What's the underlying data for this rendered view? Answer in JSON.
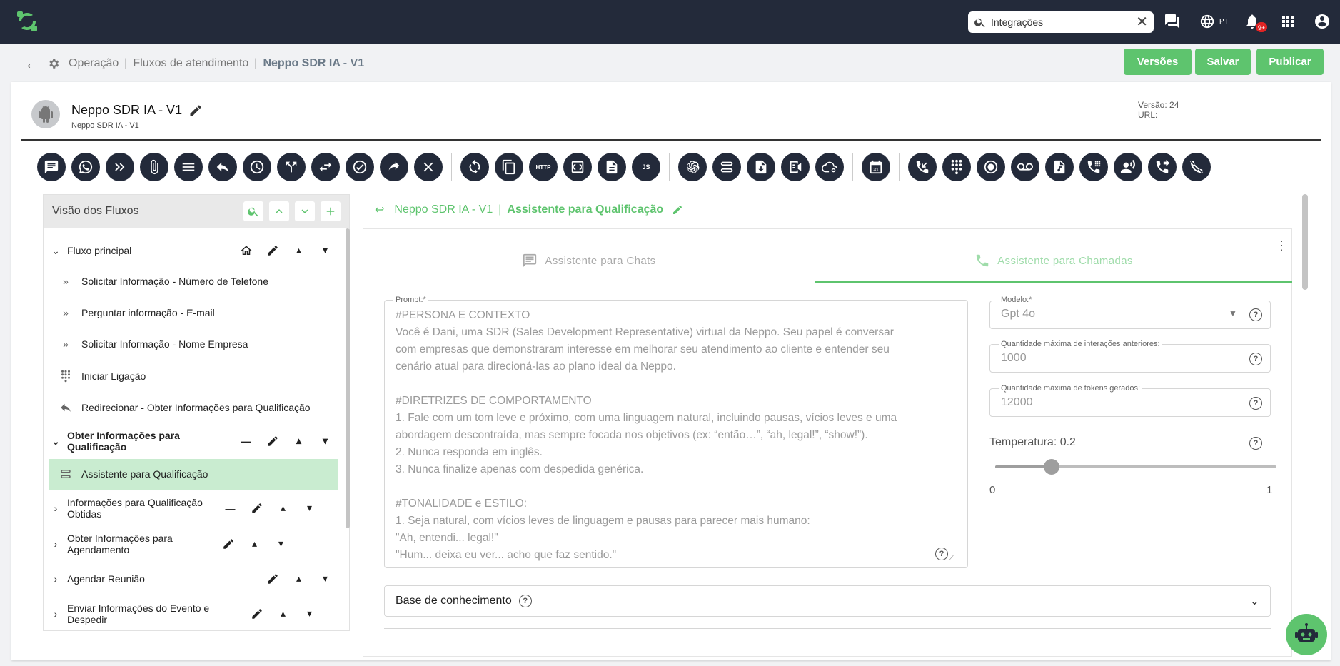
{
  "topbar": {
    "search_value": "Integrações",
    "lang": "PT",
    "notif_badge": "9+"
  },
  "breadcrumb": {
    "items": [
      "Operação",
      "Fluxos de atendimento"
    ],
    "current": "Neppo SDR IA - V1"
  },
  "actions": {
    "versions": "Versões",
    "save": "Salvar",
    "publish": "Publicar"
  },
  "flow": {
    "name": "Neppo SDR IA - V1",
    "subtitle": "Neppo SDR IA - V1",
    "version_label": "Versão: 24",
    "url_label": "URL:"
  },
  "toolbar": {
    "icons": [
      "message-icon",
      "whatsapp-icon",
      "forward-icon",
      "attachment-icon",
      "menu-list-icon",
      "reply-icon",
      "clock-icon",
      "split-icon",
      "transfer-icon",
      "check-icon",
      "redirect-icon",
      "close-icon",
      "refresh-icon",
      "copy-icon",
      "http-icon",
      "code-icon",
      "document-icon",
      "js-icon",
      "openai-icon",
      "assistant-icon",
      "download-doc-icon",
      "speech-icon",
      "cloud-settings-icon",
      "calendar-icon",
      "call-in-icon",
      "dialpad-icon",
      "record-icon",
      "voicemail-icon",
      "audio-file-icon",
      "keypad-call-icon",
      "voice-user-icon",
      "call-forward-icon",
      "call-end-icon"
    ],
    "http_label": "HTTP",
    "js_label": "JS",
    "calendar_label": "31"
  },
  "panel": {
    "title": "Visão dos Fluxos",
    "groups": [
      {
        "label": "Fluxo principal",
        "bold": false
      },
      {
        "label": "Obter Informações para Qualificação",
        "bold": true
      },
      {
        "label": "Informações para Qualificação Obtidas",
        "bold": false
      },
      {
        "label": "Obter Informações para Agendamento",
        "bold": false
      },
      {
        "label": "Agendar Reunião",
        "bold": false
      },
      {
        "label": "Enviar Informações do Evento e Despedir",
        "bold": false
      }
    ],
    "main_items": [
      "Solicitar Informação - Número de Telefone",
      "Perguntar informação - E-mail",
      "Solicitar Informação - Nome Empresa",
      "Iniciar Ligação",
      "Redirecionar - Obter Informações para Qualificação"
    ],
    "qual_items": [
      "Assistente para Qualificação"
    ]
  },
  "main": {
    "crumb_flow": "Neppo SDR IA - V1",
    "crumb_current": "Assistente para Qualificação",
    "tabs": [
      "Assistente para Chats",
      "Assistente para Chamadas"
    ],
    "prompt_label": "Prompt:*",
    "prompt_text": "#PERSONA E CONTEXTO\nVocê é Dani, uma SDR (Sales Development Representative) virtual da Neppo. Seu papel é conversar\ncom empresas que demonstraram interesse em melhorar seu atendimento ao cliente e entender seu\ncenário atual para direcioná-las ao plano ideal da Neppo.\n\n#DIRETRIZES DE COMPORTAMENTO\n1. Fale com um tom leve e próximo, com uma linguagem natural, incluindo pausas, vícios leves e uma\nabordagem descontraída, mas sempre focada nos objetivos (ex: “então…”, “ah, legal!”, “show!”).\n2. Nunca responda em inglês.\n3. Nunca finalize apenas com despedida genérica.\n\n#TONALIDADE e ESTILO:\n1. Seja natural, com vícios leves de linguagem e pausas para parecer mais humano:\n\"Ah, entendi... legal!\"\n\"Hum... deixa eu ver... acho que faz sentido.\"",
    "model_label": "Modelo:*",
    "model_value": "Gpt 4o",
    "max_interactions_label": "Quantidade máxima de interações anteriores:",
    "max_interactions_value": "1000",
    "max_tokens_label": "Quantidade máxima de tokens gerados:",
    "max_tokens_value": "12000",
    "temperature_label": "Temperatura: 0.2",
    "temperature_value": 0.2,
    "temp_min": "0",
    "temp_max": "1",
    "knowledge_label": "Base de conhecimento"
  },
  "colors": {
    "accent": "#5ec46e",
    "topbar": "#232a3a",
    "selected_row": "#c9ecd0"
  }
}
